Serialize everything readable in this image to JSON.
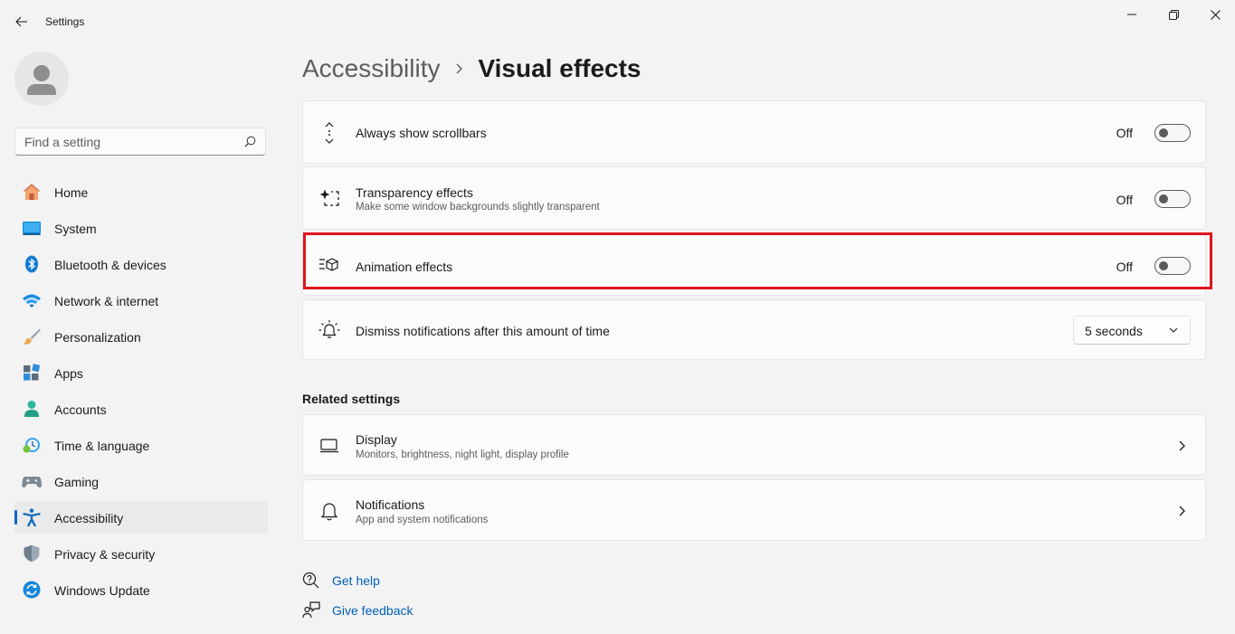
{
  "window": {
    "title": "Settings",
    "back_icon": "back-arrow-icon",
    "controls": [
      "minimize-icon",
      "maximize-icon",
      "close-icon"
    ]
  },
  "sidebar": {
    "search": {
      "placeholder": "Find a setting",
      "value": ""
    },
    "items": [
      {
        "label": "Home",
        "icon": "home-icon",
        "active": false
      },
      {
        "label": "System",
        "icon": "system-icon",
        "active": false
      },
      {
        "label": "Bluetooth & devices",
        "icon": "bluetooth-icon",
        "active": false
      },
      {
        "label": "Network & internet",
        "icon": "wifi-icon",
        "active": false
      },
      {
        "label": "Personalization",
        "icon": "brush-icon",
        "active": false
      },
      {
        "label": "Apps",
        "icon": "apps-icon",
        "active": false
      },
      {
        "label": "Accounts",
        "icon": "account-icon",
        "active": false
      },
      {
        "label": "Time & language",
        "icon": "clock-globe-icon",
        "active": false
      },
      {
        "label": "Gaming",
        "icon": "gamepad-icon",
        "active": false
      },
      {
        "label": "Accessibility",
        "icon": "accessibility-icon",
        "active": true
      },
      {
        "label": "Privacy & security",
        "icon": "shield-icon",
        "active": false
      },
      {
        "label": "Windows Update",
        "icon": "update-icon",
        "active": false
      }
    ]
  },
  "breadcrumb": {
    "parent": "Accessibility",
    "current": "Visual effects"
  },
  "settings": {
    "scrollbars": {
      "title": "Always show scrollbars",
      "state": "Off"
    },
    "transparency": {
      "title": "Transparency effects",
      "description": "Make some window backgrounds slightly transparent",
      "state": "Off"
    },
    "animation": {
      "title": "Animation effects",
      "state": "Off"
    },
    "notifications_timeout": {
      "title": "Dismiss notifications after this amount of time",
      "value": "5 seconds"
    }
  },
  "related": {
    "title": "Related settings",
    "display": {
      "title": "Display",
      "description": "Monitors, brightness, night light, display profile"
    },
    "notifications": {
      "title": "Notifications",
      "description": "App and system notifications"
    }
  },
  "links": {
    "help": "Get help",
    "feedback": "Give feedback"
  },
  "colors": {
    "accent": "#0067c0",
    "highlight": "#e0141e",
    "link": "#005fb8"
  }
}
